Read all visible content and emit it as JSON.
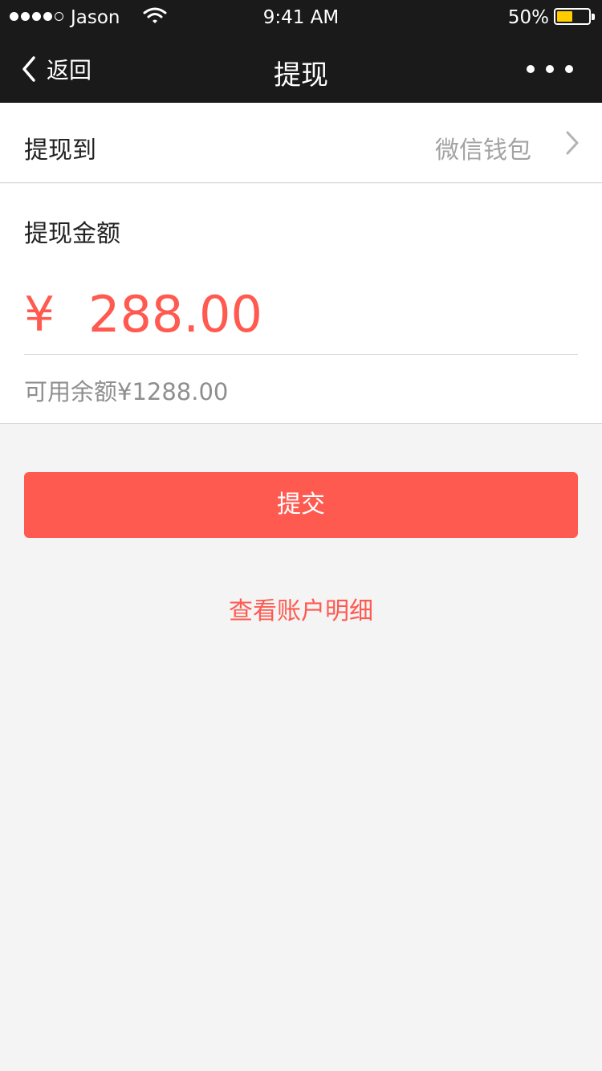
{
  "status_bar": {
    "carrier": "Jason",
    "time": "9:41 AM",
    "battery_percent": "50%",
    "battery_level": 0.5,
    "signal_bars_filled": 4,
    "signal_bars_total": 5,
    "battery_color": "#ffcc00"
  },
  "nav": {
    "back_label": "返回",
    "title": "提现",
    "more_icon": "more-dots-icon"
  },
  "withdraw_to": {
    "label": "提现到",
    "value": "微信钱包"
  },
  "amount": {
    "label": "提现金额",
    "currency_symbol": "¥",
    "value": "288.00",
    "balance_text": "可用余额¥1288.00"
  },
  "submit_label": "提交",
  "details_link": "查看账户明细",
  "colors": {
    "accent": "#ff5a50",
    "bar_background": "#1a1a1a",
    "page_background": "#f4f4f4"
  }
}
